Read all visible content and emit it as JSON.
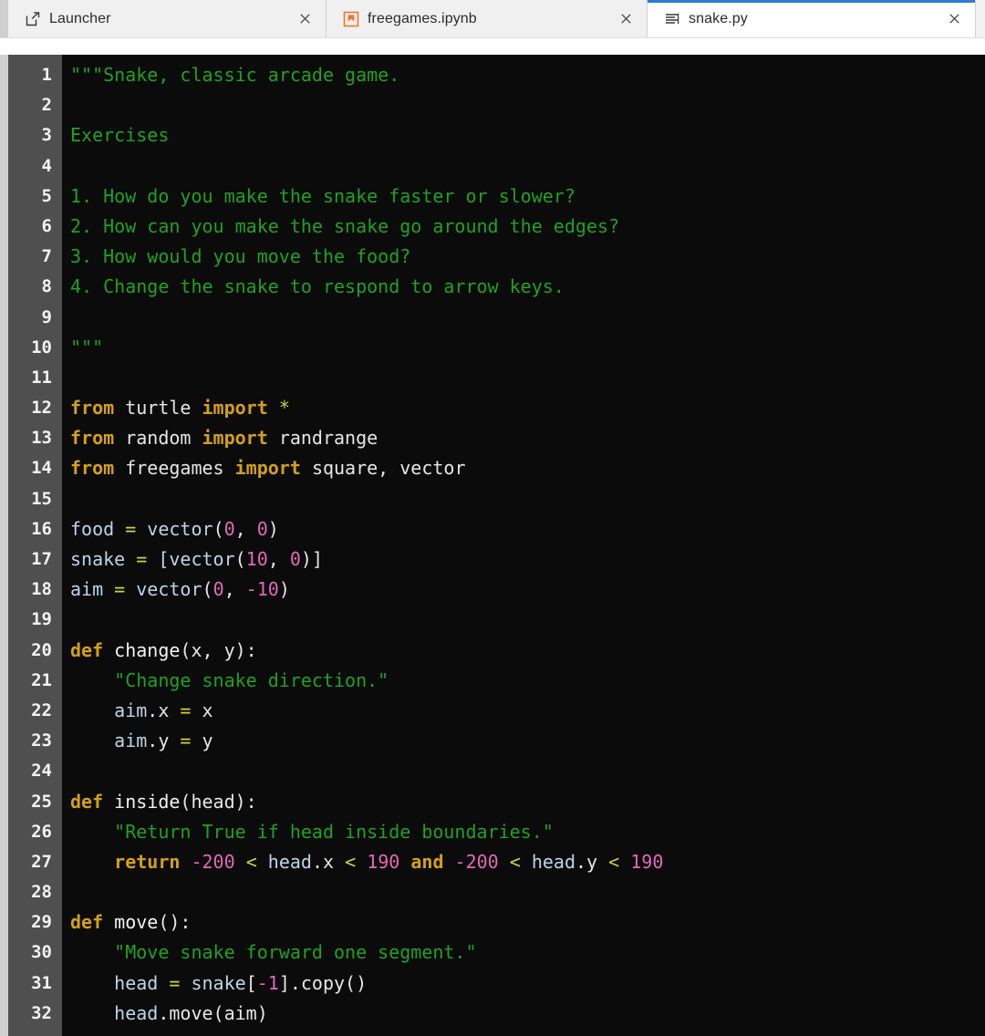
{
  "tabs": [
    {
      "id": "launcher",
      "label": "Launcher",
      "icon": "launcher-icon",
      "active": false,
      "close_label": "×"
    },
    {
      "id": "freegames",
      "label": "freegames.ipynb",
      "icon": "notebook-icon",
      "active": false,
      "close_label": "×"
    },
    {
      "id": "snakepy",
      "label": "snake.py",
      "icon": "text-file-icon",
      "active": true,
      "close_label": "×"
    }
  ],
  "editor": {
    "filename": "snake.py",
    "language": "Python",
    "theme": "dark",
    "first_visible_line": 1,
    "last_visible_line": 32,
    "colors": {
      "background": "#0b0b0b",
      "gutter_background": "#4f4f4f",
      "gutter_text": "#f2f2f2",
      "string": "#21a121",
      "keyword": "#d4a017",
      "number": "#e268b8",
      "operator": "#c9d43a",
      "variable": "#bcd5e8",
      "default_text": "#e6e6e6",
      "active_tab_accent": "#2b7cd3"
    },
    "line_numbers": [
      "1",
      "2",
      "3",
      "4",
      "5",
      "6",
      "7",
      "8",
      "9",
      "10",
      "11",
      "12",
      "13",
      "14",
      "15",
      "16",
      "17",
      "18",
      "19",
      "20",
      "21",
      "22",
      "23",
      "24",
      "25",
      "26",
      "27",
      "28",
      "29",
      "30",
      "31",
      "32"
    ],
    "lines": [
      {
        "n": "1",
        "text": "\"\"\"Snake, classic arcade game."
      },
      {
        "n": "2",
        "text": ""
      },
      {
        "n": "3",
        "text": "Exercises"
      },
      {
        "n": "4",
        "text": ""
      },
      {
        "n": "5",
        "text": "1. How do you make the snake faster or slower?"
      },
      {
        "n": "6",
        "text": "2. How can you make the snake go around the edges?"
      },
      {
        "n": "7",
        "text": "3. How would you move the food?"
      },
      {
        "n": "8",
        "text": "4. Change the snake to respond to arrow keys."
      },
      {
        "n": "9",
        "text": ""
      },
      {
        "n": "10",
        "text": "\"\"\""
      },
      {
        "n": "11",
        "text": ""
      },
      {
        "n": "12",
        "text": "from turtle import *"
      },
      {
        "n": "13",
        "text": "from random import randrange"
      },
      {
        "n": "14",
        "text": "from freegames import square, vector"
      },
      {
        "n": "15",
        "text": ""
      },
      {
        "n": "16",
        "text": "food = vector(0, 0)"
      },
      {
        "n": "17",
        "text": "snake = [vector(10, 0)]"
      },
      {
        "n": "18",
        "text": "aim = vector(0, -10)"
      },
      {
        "n": "19",
        "text": ""
      },
      {
        "n": "20",
        "text": "def change(x, y):"
      },
      {
        "n": "21",
        "text": "    \"Change snake direction.\""
      },
      {
        "n": "22",
        "text": "    aim.x = x"
      },
      {
        "n": "23",
        "text": "    aim.y = y"
      },
      {
        "n": "24",
        "text": ""
      },
      {
        "n": "25",
        "text": "def inside(head):"
      },
      {
        "n": "26",
        "text": "    \"Return True if head inside boundaries.\""
      },
      {
        "n": "27",
        "text": "    return -200 < head.x < 190 and -200 < head.y < 190"
      },
      {
        "n": "28",
        "text": ""
      },
      {
        "n": "29",
        "text": "def move():"
      },
      {
        "n": "30",
        "text": "    \"Move snake forward one segment.\""
      },
      {
        "n": "31",
        "text": "    head = snake[-1].copy()"
      },
      {
        "n": "32",
        "text": "    head.move(aim)"
      }
    ],
    "tokens": [
      [
        {
          "t": "\"\"\"Snake, classic arcade game.",
          "c": "t-str"
        }
      ],
      [],
      [
        {
          "t": "Exercises",
          "c": "t-str"
        }
      ],
      [],
      [
        {
          "t": "1. How do you make the snake faster or slower?",
          "c": "t-str"
        }
      ],
      [
        {
          "t": "2. How can you make the snake go around the edges?",
          "c": "t-str"
        }
      ],
      [
        {
          "t": "3. How would you move the food?",
          "c": "t-str"
        }
      ],
      [
        {
          "t": "4. Change the snake to respond to arrow keys.",
          "c": "t-str"
        }
      ],
      [],
      [
        {
          "t": "\"\"\"",
          "c": "t-str"
        }
      ],
      [],
      [
        {
          "t": "from",
          "c": "t-kw"
        },
        {
          "t": " ",
          "c": "t-punct"
        },
        {
          "t": "turtle",
          "c": "t-mod"
        },
        {
          "t": " ",
          "c": "t-punct"
        },
        {
          "t": "import",
          "c": "t-kw"
        },
        {
          "t": " ",
          "c": "t-punct"
        },
        {
          "t": "*",
          "c": "t-op"
        }
      ],
      [
        {
          "t": "from",
          "c": "t-kw"
        },
        {
          "t": " ",
          "c": "t-punct"
        },
        {
          "t": "random",
          "c": "t-mod"
        },
        {
          "t": " ",
          "c": "t-punct"
        },
        {
          "t": "import",
          "c": "t-kw"
        },
        {
          "t": " ",
          "c": "t-punct"
        },
        {
          "t": "randrange",
          "c": "t-mod"
        }
      ],
      [
        {
          "t": "from",
          "c": "t-kw"
        },
        {
          "t": " ",
          "c": "t-punct"
        },
        {
          "t": "freegames",
          "c": "t-mod"
        },
        {
          "t": " ",
          "c": "t-punct"
        },
        {
          "t": "import",
          "c": "t-kw"
        },
        {
          "t": " ",
          "c": "t-punct"
        },
        {
          "t": "square, vector",
          "c": "t-mod"
        }
      ],
      [],
      [
        {
          "t": "food ",
          "c": "t-var"
        },
        {
          "t": "=",
          "c": "t-op"
        },
        {
          "t": " vector",
          "c": "t-var"
        },
        {
          "t": "(",
          "c": "t-punct"
        },
        {
          "t": "0",
          "c": "t-num"
        },
        {
          "t": ", ",
          "c": "t-punct"
        },
        {
          "t": "0",
          "c": "t-num"
        },
        {
          "t": ")",
          "c": "t-punct"
        }
      ],
      [
        {
          "t": "snake ",
          "c": "t-var"
        },
        {
          "t": "=",
          "c": "t-op"
        },
        {
          "t": " [vector",
          "c": "t-var"
        },
        {
          "t": "(",
          "c": "t-punct"
        },
        {
          "t": "10",
          "c": "t-num"
        },
        {
          "t": ", ",
          "c": "t-punct"
        },
        {
          "t": "0",
          "c": "t-num"
        },
        {
          "t": ")]",
          "c": "t-punct"
        }
      ],
      [
        {
          "t": "aim ",
          "c": "t-var"
        },
        {
          "t": "=",
          "c": "t-op"
        },
        {
          "t": " vector",
          "c": "t-var"
        },
        {
          "t": "(",
          "c": "t-punct"
        },
        {
          "t": "0",
          "c": "t-num"
        },
        {
          "t": ", ",
          "c": "t-punct"
        },
        {
          "t": "-10",
          "c": "t-num"
        },
        {
          "t": ")",
          "c": "t-punct"
        }
      ],
      [],
      [
        {
          "t": "def",
          "c": "t-kw"
        },
        {
          "t": " ",
          "c": "t-punct"
        },
        {
          "t": "change",
          "c": "t-name"
        },
        {
          "t": "(x, y):",
          "c": "t-punct"
        }
      ],
      [
        {
          "t": "    \"Change snake direction.\"",
          "c": "t-str"
        }
      ],
      [
        {
          "t": "    aim",
          "c": "t-var"
        },
        {
          "t": ".x ",
          "c": "t-punct"
        },
        {
          "t": "=",
          "c": "t-op"
        },
        {
          "t": " x",
          "c": "t-punct"
        }
      ],
      [
        {
          "t": "    aim",
          "c": "t-var"
        },
        {
          "t": ".y ",
          "c": "t-punct"
        },
        {
          "t": "=",
          "c": "t-op"
        },
        {
          "t": " y",
          "c": "t-punct"
        }
      ],
      [],
      [
        {
          "t": "def",
          "c": "t-kw"
        },
        {
          "t": " ",
          "c": "t-punct"
        },
        {
          "t": "inside",
          "c": "t-name"
        },
        {
          "t": "(head):",
          "c": "t-punct"
        }
      ],
      [
        {
          "t": "    \"Return True if head inside boundaries.\"",
          "c": "t-str"
        }
      ],
      [
        {
          "t": "    ",
          "c": "t-punct"
        },
        {
          "t": "return",
          "c": "t-kw"
        },
        {
          "t": " ",
          "c": "t-punct"
        },
        {
          "t": "-200",
          "c": "t-num"
        },
        {
          "t": " ",
          "c": "t-punct"
        },
        {
          "t": "<",
          "c": "t-op"
        },
        {
          "t": " ",
          "c": "t-punct"
        },
        {
          "t": "head",
          "c": "t-var"
        },
        {
          "t": ".x",
          "c": "t-punct"
        },
        {
          "t": " ",
          "c": "t-punct"
        },
        {
          "t": "<",
          "c": "t-op"
        },
        {
          "t": " ",
          "c": "t-punct"
        },
        {
          "t": "190",
          "c": "t-num"
        },
        {
          "t": " ",
          "c": "t-punct"
        },
        {
          "t": "and",
          "c": "t-kw"
        },
        {
          "t": " ",
          "c": "t-punct"
        },
        {
          "t": "-200",
          "c": "t-num"
        },
        {
          "t": " ",
          "c": "t-punct"
        },
        {
          "t": "<",
          "c": "t-op"
        },
        {
          "t": " ",
          "c": "t-punct"
        },
        {
          "t": "head",
          "c": "t-var"
        },
        {
          "t": ".y",
          "c": "t-punct"
        },
        {
          "t": " ",
          "c": "t-punct"
        },
        {
          "t": "<",
          "c": "t-op"
        },
        {
          "t": " ",
          "c": "t-punct"
        },
        {
          "t": "190",
          "c": "t-num"
        }
      ],
      [],
      [
        {
          "t": "def",
          "c": "t-kw"
        },
        {
          "t": " ",
          "c": "t-punct"
        },
        {
          "t": "move",
          "c": "t-name"
        },
        {
          "t": "():",
          "c": "t-punct"
        }
      ],
      [
        {
          "t": "    \"Move snake forward one segment.\"",
          "c": "t-str"
        }
      ],
      [
        {
          "t": "    head ",
          "c": "t-var"
        },
        {
          "t": "=",
          "c": "t-op"
        },
        {
          "t": " snake",
          "c": "t-var"
        },
        {
          "t": "[",
          "c": "t-punct"
        },
        {
          "t": "-1",
          "c": "t-num"
        },
        {
          "t": "].copy()",
          "c": "t-punct"
        }
      ],
      [
        {
          "t": "    head",
          "c": "t-var"
        },
        {
          "t": ".move(aim)",
          "c": "t-punct"
        }
      ]
    ]
  }
}
